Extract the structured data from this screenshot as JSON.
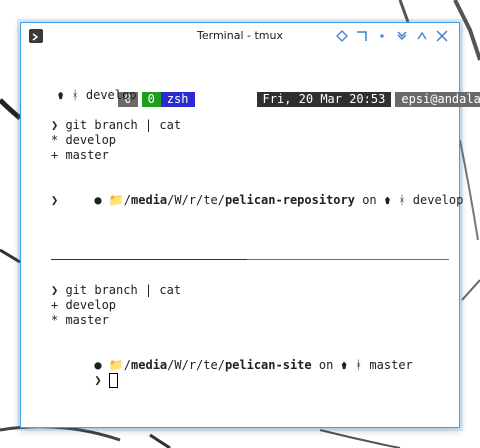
{
  "window": {
    "title": "Terminal - tmux"
  },
  "statusbar": {
    "session": "0",
    "window_index": "0",
    "window_name": "zsh",
    "datetime": "Fri, 20 Mar 20:53",
    "user_host": "epsi@andalan",
    "branch_line": "⚱ ᚼ develop"
  },
  "pane_top": {
    "command": "❯ git branch | cat",
    "branches": [
      "* develop",
      "+ master"
    ],
    "prompt": {
      "bullet": "●",
      "folder_icon": "📁",
      "path_sep": "/",
      "path_media": "media",
      "path_mid": "/W/r/te/",
      "path_repo": "pelican-repository",
      "on": " on ",
      "vcs_icons": "⚱ ᚼ",
      "branch": " develop"
    },
    "input_prompt": "❯"
  },
  "pane_bottom": {
    "command": "❯ git branch | cat",
    "branches": [
      "+ develop",
      "* master"
    ],
    "prompt": {
      "bullet": "●",
      "folder_icon": "📁",
      "path_sep": "/",
      "path_media": "media",
      "path_mid": "/W/r/te/",
      "path_repo": "pelican-site",
      "on": " on ",
      "vcs_icons": "⚱ ᚼ",
      "branch": " master"
    },
    "input_prompt": "❯"
  },
  "colors": {
    "window_border": "#3fa1e8",
    "status_session_bg": "#6a6a6a",
    "status_index_bg": "#1e9e1e",
    "status_name_bg": "#2b2bd0",
    "status_dark_bg": "#303030",
    "status_user_bg": "#6a6a6a",
    "active_separator": "#2e9e3e"
  }
}
